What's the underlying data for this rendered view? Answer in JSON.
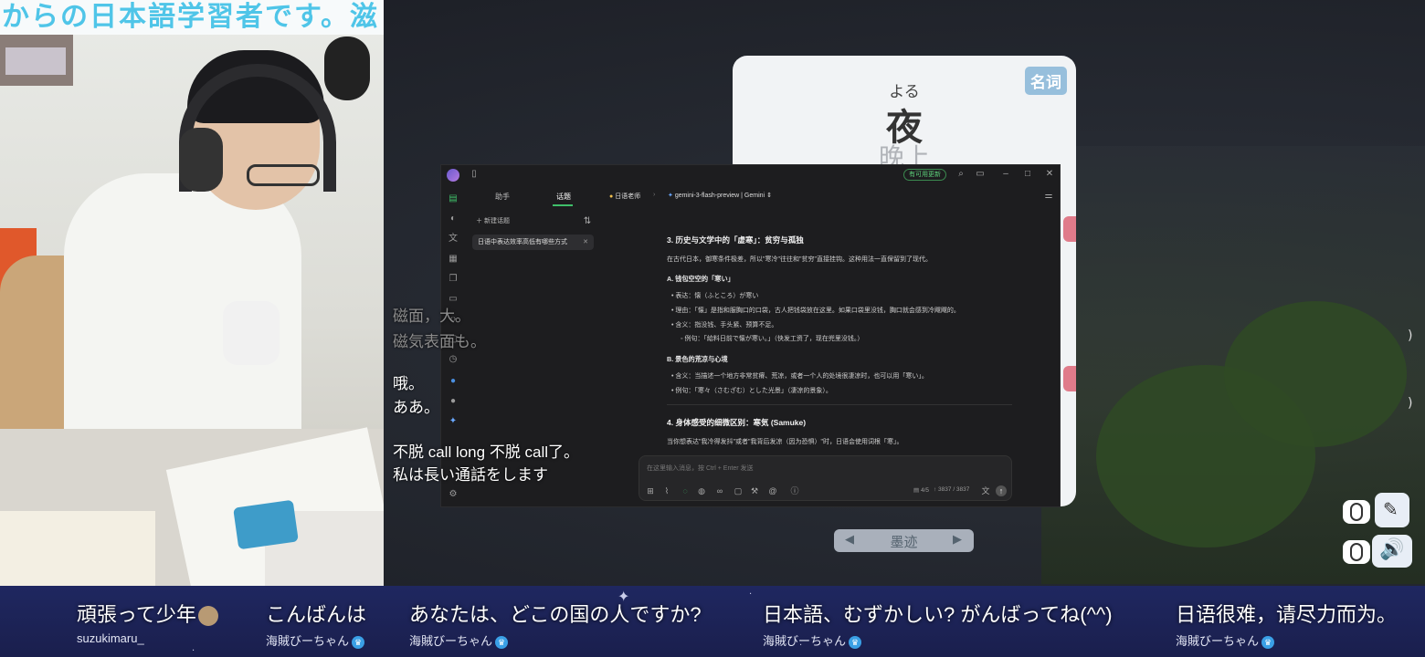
{
  "webcam": {
    "banner_text": "からの日本語学習者です。滋"
  },
  "subtitles": {
    "line1": "磁面，大。",
    "line2": "磁気表面も。",
    "line3": "哦。",
    "line4": "ああ。",
    "line5": "不脱 call long 不脱 call了。",
    "line6": "私は長い通話をします"
  },
  "flashcard": {
    "tag": "名词",
    "reading": "よる",
    "kanji": "夜",
    "meaning": "晚上"
  },
  "app": {
    "update_label": "有可用更新",
    "sidebar": {
      "tab_assistant": "助手",
      "tab_topics": "话题",
      "new_topic": "新建话题",
      "topic_item": "日语中表达效率高低有哪些方式"
    },
    "header": {
      "assistant_name": "日语老师",
      "model_name": "gemini-3-flash-preview | Gemini"
    },
    "content": {
      "h3_history": "3. 历史与文学中的「虚寒」：贫穷与孤独",
      "p_history": "在古代日本，御寒条件极差，所以\"寒冷\"往往和\"贫穷\"直接挂钩。这种用法一直保留到了现代。",
      "h4_a": "A. 钱包空空的「寒い」",
      "a_express": "表达：懐（ふところ）が寒い",
      "a_reason": "理由：「懐」是指和服胸口的口袋，古人把钱袋放在这里。如果口袋里没钱，胸口就会感到冷飕飕的。",
      "a_meaning": "含义：指没钱、手头紧、预算不足。",
      "a_example": "例句：「給料日前で懐が寒い。」（快发工资了，现在兜里没钱。）",
      "h4_b": "B. 景色的荒凉与心境",
      "b_meaning": "含义：当描述一个地方非常贫瘠、荒凉，或者一个人的处境很凄凉时，也可以用「寒い」。",
      "b_example": "例句：「寒々（さむざむ）とした光景」（凄凉的景象）。",
      "h3_body": "4. 身体感受的细微区别：寒気 (Samuke)",
      "p_body": "当你想表达\"我冷得发抖\"或者\"我背后发凉（因为恐惧）\"时，日语会使用词根「寒」。"
    },
    "input": {
      "placeholder": "在这里输入消息，按 Ctrl + Enter 发送",
      "page_stat": "4/5",
      "token_stat": "↑ 3837 / 3837"
    }
  },
  "pager": {
    "label": "墨迹"
  },
  "chat": [
    {
      "message": "頑張って少年",
      "user": "suzukimaru_"
    },
    {
      "message": "こんばんは",
      "user": "海賊びーちゃん"
    },
    {
      "message": "あなたは、どこの国の人ですか?",
      "user": "海賊びーちゃん"
    },
    {
      "message": "日本語、むずかしい? がんばってね(^^)",
      "user": "海賊びーちゃん"
    },
    {
      "message": "日语很难，请尽力而为。",
      "user": "海賊びーちゃん"
    }
  ],
  "colors": {
    "accent_green": "#3fbf6a",
    "chat_bg": "#1f2760",
    "banner_text": "#4fc5e8",
    "card_tag": "#97bfdc"
  }
}
